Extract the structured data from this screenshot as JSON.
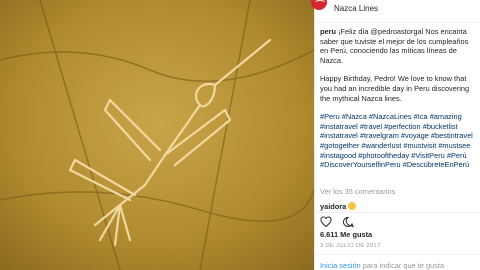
{
  "header": {
    "location": "Nazca Lines"
  },
  "caption": {
    "username": "peru",
    "spanish_text": "¡Feliz día @pedroastorgal Nos encanta saber que tuviste el mejor de los cumpleaños en Perú, conociendo las míticas líneas de Nazca.",
    "english_text": "Happy Birthday, Pedro! We love to know that you had an incredible day in Peru discovering the mythical Nazca lines.",
    "hashtags": "#Peru #Nazca #NazcaLines #Ica #amazing #instatravel #travel #perfection #bucketlist #instatravel #travelgram #voyage #bestintravel #gotogether #wanderlust #mustvisit #mustsee #instagood #photooftheday #VisitPeru #Perú #DiscoverYourselfinPeru #DescúbreteEnPerú"
  },
  "comments": {
    "view_all": "Ver los 35 comentarios",
    "first": {
      "username": "yaidora"
    }
  },
  "actions": {
    "like_icon": "heart-icon",
    "comment_icon": "comment-icon"
  },
  "likes": "6.611 Me gusta",
  "date": "3 DE JULIO DE 2017",
  "login": {
    "link": "Inicia sesión",
    "text": " para indicar que te gusta"
  },
  "colors": {
    "brand": "#d9262c",
    "link": "#3897f0",
    "hashtag": "#003569",
    "muted": "#999999"
  }
}
